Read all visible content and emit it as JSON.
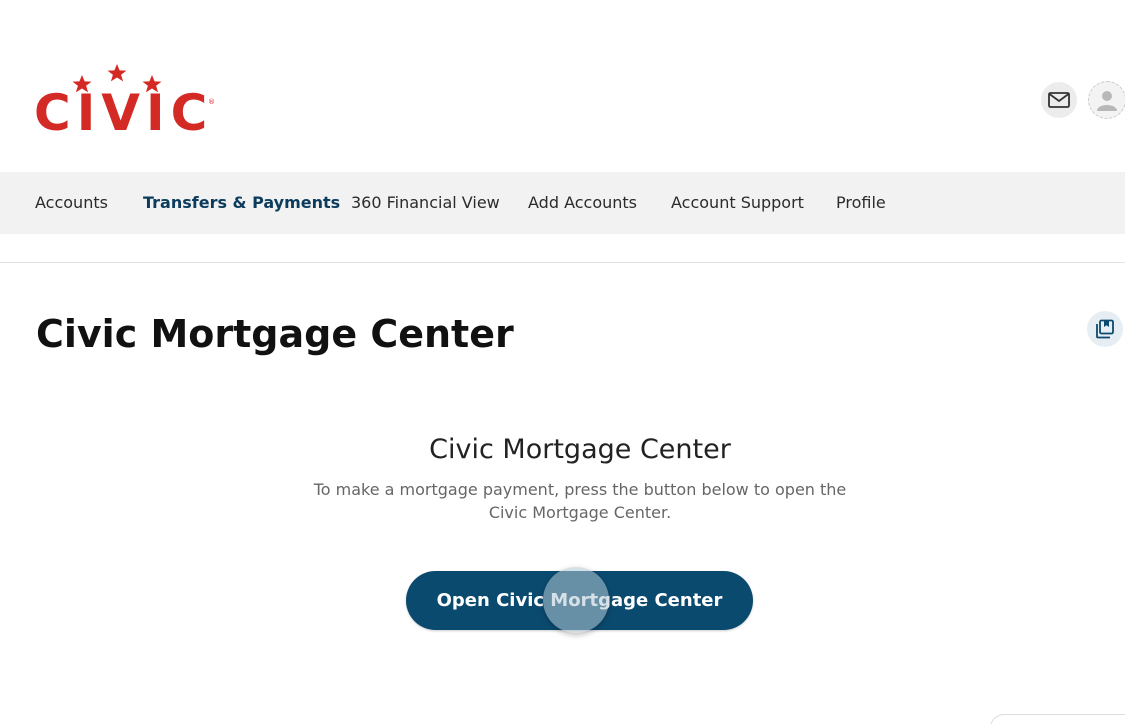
{
  "brand": {
    "logo_text": "CIVIC",
    "logo_registered": "®",
    "color": "#d42a25"
  },
  "header": {
    "mail_icon": "mail-icon",
    "avatar_icon": "user-avatar-icon"
  },
  "nav": {
    "items": [
      {
        "label": "Accounts",
        "active": false
      },
      {
        "label": "Transfers & Payments",
        "active": true
      },
      {
        "label": "360 Financial View",
        "active": false
      },
      {
        "label": "Add Accounts",
        "active": false
      },
      {
        "label": "Account Support",
        "active": false
      },
      {
        "label": "Profile",
        "active": false
      }
    ],
    "active_color": "#0b3c5d"
  },
  "page": {
    "title": "Civic Mortgage Center",
    "save_icon": "bookmark-pages-icon"
  },
  "content": {
    "heading": "Civic Mortgage Center",
    "description": "To make a mortgage payment, press the button below to open the Civic Mortgage Center.",
    "button_label": "Open Civic Mortgage Center",
    "button_color": "#0b4a6f"
  }
}
